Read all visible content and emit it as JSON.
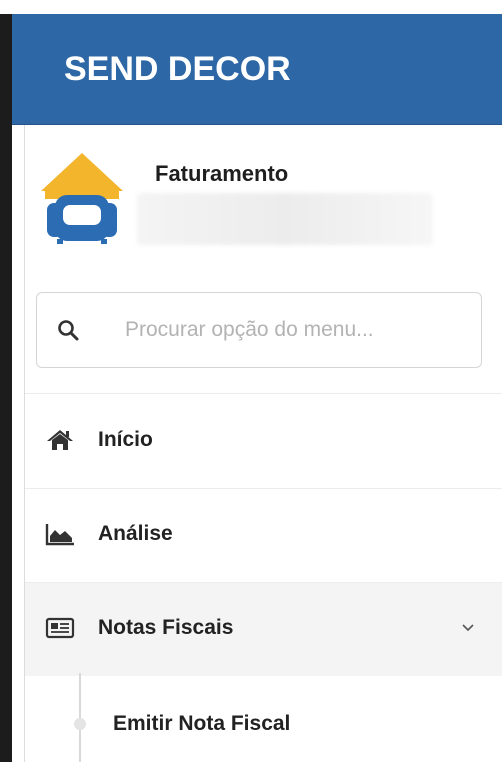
{
  "header": {
    "brand": "SEND DECOR"
  },
  "profile": {
    "name": "Faturamento",
    "logo_icon": "sofa-house-logo"
  },
  "search": {
    "placeholder": "Procurar opção do menu...",
    "value": "",
    "icon": "search-icon"
  },
  "menu": {
    "items": [
      {
        "label": "Início",
        "icon": "home-icon"
      },
      {
        "label": "Análise",
        "icon": "area-chart-icon"
      },
      {
        "label": "Notas Fiscais",
        "icon": "newspaper-icon",
        "expanded": true,
        "chevron": "chevron-down-icon"
      }
    ],
    "subitems": [
      {
        "label": "Emitir Nota Fiscal"
      }
    ]
  },
  "colors": {
    "header_bg": "#2e67a6",
    "active_item_bg": "#f4f4f4",
    "logo_roof": "#f2b52b",
    "logo_sofa": "#2b6cb3"
  }
}
